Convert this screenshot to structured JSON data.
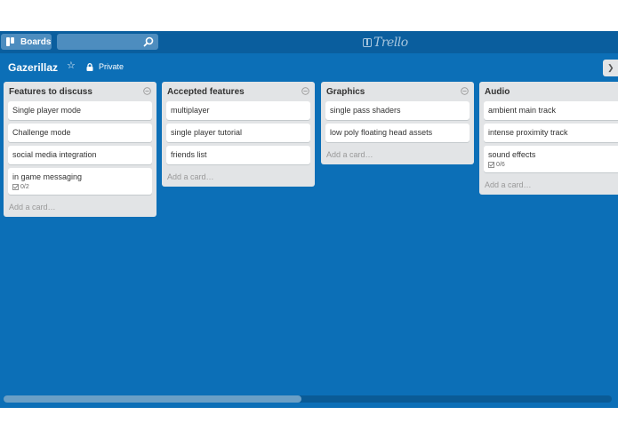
{
  "header": {
    "boards_label": "Boards",
    "search_placeholder": "",
    "logo_text": "Trello"
  },
  "board": {
    "title": "Gazerillaz",
    "privacy_label": "Private"
  },
  "lists": [
    {
      "title": "Features to discuss",
      "cards": [
        {
          "title": "Single player mode"
        },
        {
          "title": "Challenge mode"
        },
        {
          "title": "social media integration"
        },
        {
          "title": "in game messaging",
          "checklist": "0/2"
        }
      ],
      "add_card_label": "Add a card…"
    },
    {
      "title": "Accepted features",
      "cards": [
        {
          "title": "multiplayer"
        },
        {
          "title": "single player tutorial"
        },
        {
          "title": "friends list"
        }
      ],
      "add_card_label": "Add a card…"
    },
    {
      "title": "Graphics",
      "cards": [
        {
          "title": "single pass shaders"
        },
        {
          "title": "low poly floating head assets"
        }
      ],
      "add_card_label": "Add a card…"
    },
    {
      "title": "Audio",
      "cards": [
        {
          "title": "ambient main track"
        },
        {
          "title": "intense proximity track"
        },
        {
          "title": "sound effects",
          "checklist": "0/6"
        }
      ],
      "add_card_label": "Add a card…"
    }
  ],
  "colors": {
    "board_background": "#0c6fb7",
    "header_background": "#0a5e9e",
    "list_background": "#e2e4e6"
  },
  "icons": [
    "boards-icon",
    "search-icon",
    "trello-logo-icon",
    "star-icon",
    "lock-icon",
    "list-menu-icon",
    "checklist-icon",
    "chevron-right-icon"
  ],
  "scrollbar": {
    "position_fraction": 0.49
  }
}
